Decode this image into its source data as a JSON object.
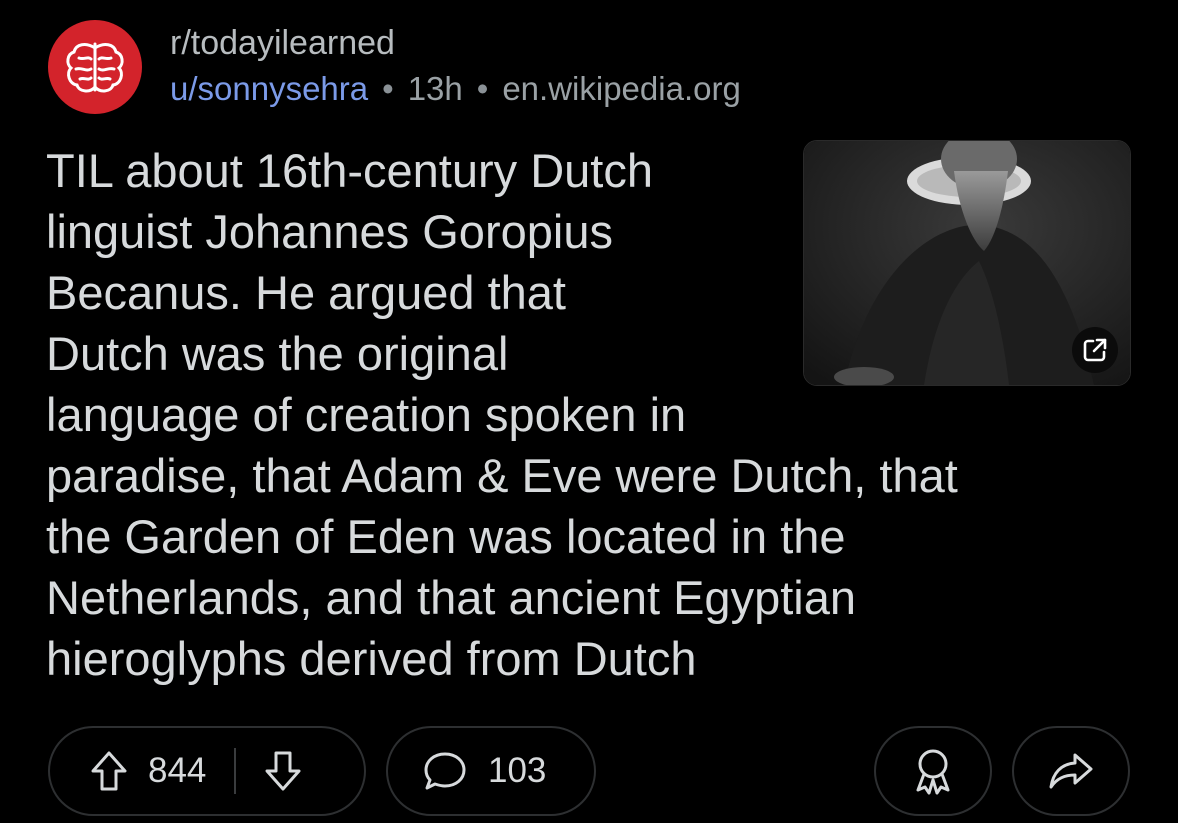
{
  "post": {
    "subreddit": "r/todayilearned",
    "author": "u/sonnysehra",
    "age": "13h",
    "domain": "en.wikipedia.org",
    "title": "TIL about 16th-century Dutch linguist Johannes Goropius Becanus. He argued that Dutch was the original language of creation spoken in paradise, that Adam & Eve were Dutch, that the Garden of Eden was located in the Netherlands, and that ancient Egyptian hieroglyphs derived from Dutch",
    "title_lines": [
      "TIL about 16th-century Dutch",
      "linguist Johannes Goropius",
      "Becanus. He argued that",
      "Dutch was the original",
      "language of creation spoken in",
      "paradise, that Adam & Eve were Dutch, that",
      "the Garden of Eden was located in the",
      "Netherlands, and that ancient Egyptian",
      "hieroglyphs derived from Dutch"
    ]
  },
  "actions": {
    "upvotes": "844",
    "comments": "103"
  },
  "icons": {
    "avatar": "brain-icon",
    "thumbnail_overlay": "external-link-icon",
    "upvote": "arrow-up-icon",
    "downvote": "arrow-down-icon",
    "comment": "speech-bubble-icon",
    "award": "award-icon",
    "share": "share-arrow-icon"
  },
  "colors": {
    "background": "#000000",
    "avatar_red": "#d3232b",
    "username_blue": "#7b9ae8",
    "text": "#d7dadc"
  }
}
